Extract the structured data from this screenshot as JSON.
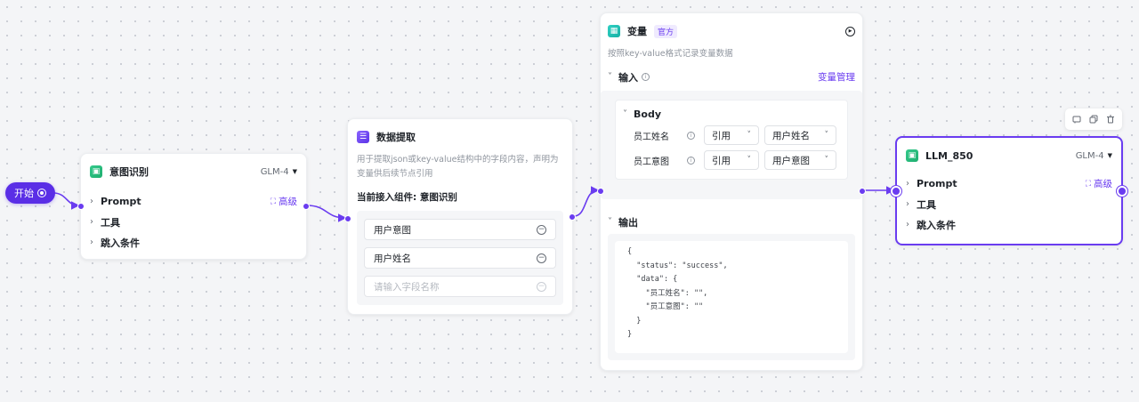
{
  "start": {
    "label": "开始"
  },
  "intent_node": {
    "title": "意图识别",
    "model": "GLM-4",
    "rows": [
      "Prompt",
      "工具",
      "跳入条件"
    ],
    "advanced": "高级"
  },
  "extract_node": {
    "title": "数据提取",
    "description": "用于提取json或key-value结构中的字段内容，声明为变量供后续节点引用",
    "current_label": "当前接入组件: 意图识别",
    "fields": [
      "用户意图",
      "用户姓名"
    ],
    "field_placeholder": "请输入字段名称"
  },
  "var_node": {
    "title": "变量",
    "tag": "官方",
    "description": "按照key-value格式记录变量数据",
    "input_label": "输入",
    "manage_label": "变量管理",
    "body_label": "Body",
    "rows": [
      {
        "name": "员工姓名",
        "type": "引用",
        "value": "用户姓名"
      },
      {
        "name": "员工意图",
        "type": "引用",
        "value": "用户意图"
      }
    ],
    "output_label": "输出",
    "output_code": "{\n  \"status\": \"success\",\n  \"data\": {\n    \"员工姓名\": \"\",\n    \"员工意图\": \"\"\n  }\n}"
  },
  "llm_node": {
    "title": "LLM_850",
    "model": "GLM-4",
    "rows": [
      "Prompt",
      "工具",
      "跳入条件"
    ],
    "advanced": "高级"
  },
  "colors": {
    "accent": "#6a3cf0",
    "start_bg": "#5a2ee6"
  }
}
